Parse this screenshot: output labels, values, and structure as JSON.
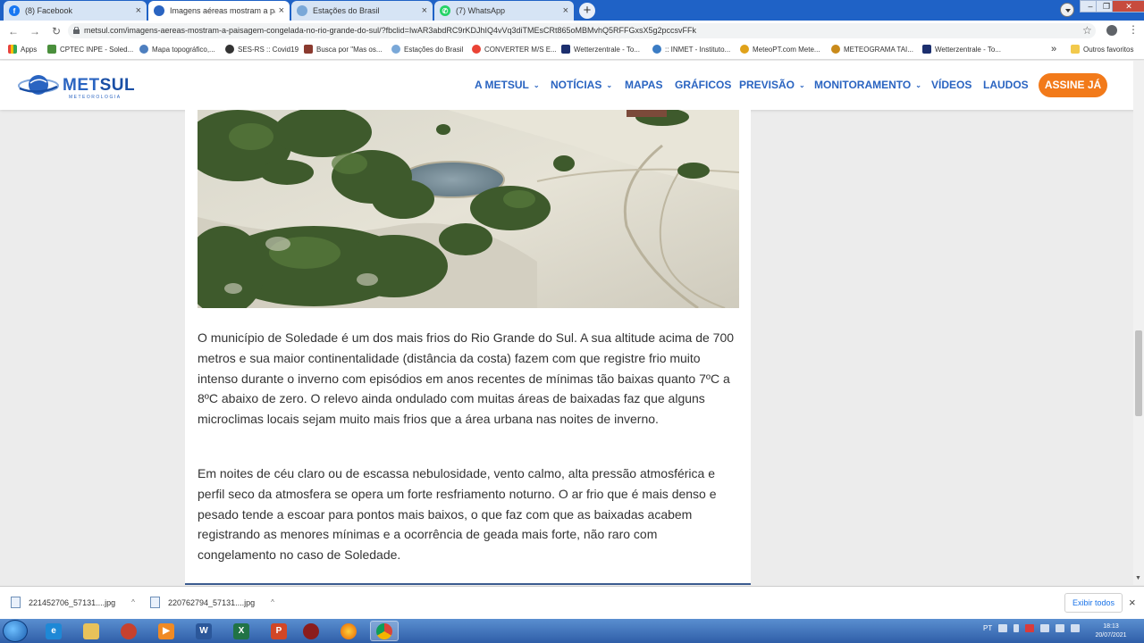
{
  "browser": {
    "tabs": [
      {
        "title": "(8) Facebook",
        "icon": "facebook-icon",
        "color": "#1877f2"
      },
      {
        "title": "Imagens aéreas mostram a paisagem",
        "icon": "metsul-icon",
        "color": "#2a64c1",
        "active": true
      },
      {
        "title": "Estações do Brasil",
        "icon": "stations-icon",
        "color": "#7aa8d8"
      },
      {
        "title": "(7) WhatsApp",
        "icon": "whatsapp-icon",
        "color": "#25d366"
      }
    ],
    "new_tab": "+",
    "url": "metsul.com/imagens-aereas-mostram-a-paisagem-congelada-no-rio-grande-do-sul/?fbclid=IwAR3abdRC9rKDJhIQ4vVq3diTMEsCRt865oMBMvhQ5RFFGxsX5g2pccsvFFk",
    "bookmarks": [
      "Apps",
      "CPTEC INPE - Soled...",
      "Mapa topográfico,...",
      "SES-RS :: Covid19",
      "Busca por \"Mas os...",
      "Estações do Brasil",
      "CONVERTER M/S E...",
      "Wetterzentrale - To...",
      ":: INMET - Instituto...",
      "MeteoPT.com Mete...",
      "METEOGRAMA TAI...",
      "Wetterzentrale - To..."
    ],
    "more_bookmarks": "»",
    "other_bookmarks": "Outros favoritos"
  },
  "site": {
    "logo_main": "MET",
    "logo_bold": "SUL",
    "logo_sub": "METEOROLOGIA",
    "menu": [
      {
        "label": "A METSUL",
        "dropdown": true
      },
      {
        "label": "NOTÍCIAS",
        "dropdown": true
      },
      {
        "label": "MAPAS",
        "dropdown": false
      },
      {
        "label": "GRÁFICOS",
        "dropdown": false
      },
      {
        "label": "PREVISÃO",
        "dropdown": true
      },
      {
        "label": "MONITORAMENTO",
        "dropdown": true
      },
      {
        "label": "VÍDEOS",
        "dropdown": false
      },
      {
        "label": "LAUDOS",
        "dropdown": false
      }
    ],
    "cta": "ASSINE JÁ",
    "accent": "#2a64c1",
    "cta_color": "#f27a1a"
  },
  "article": {
    "paragraphs": [
      "O município de Soledade é um dos mais frios do Rio Grande do Sul. A sua altitude acima de 700 metros e sua maior continentalidade (distância da costa) fazem com que registre frio muito intenso durante o inverno com episódios em anos recentes de mínimas tão baixas quanto 7ºC a 8ºC abaixo de zero. O relevo ainda ondulado com muitas áreas de baixadas faz que alguns microclimas locais sejam muito mais frios que a área urbana nas noites de inverno.",
      "Em noites de céu claro ou de escassa nebulosidade, vento calmo, alta pressão atmosférica e perfil seco da atmosfera se opera um forte resfriamento noturno. O ar frio que é mais denso e pesado tende a escoar para pontos mais baixos, o que faz com que as baixadas acabem registrando as menores mínimas e a ocorrência de geada mais forte, não raro com congelamento no caso de Soledade."
    ]
  },
  "downloads": {
    "items": [
      "221452706_57131....jpg",
      "220762794_57131....jpg"
    ],
    "show_all": "Exibir todos",
    "close": "×"
  },
  "taskbar": {
    "apps": [
      "ie-icon",
      "explorer-icon",
      "app-icon",
      "media-player-icon",
      "word-icon",
      "excel-icon",
      "powerpoint-icon",
      "app-icon",
      "firefox-icon",
      "chrome-icon"
    ],
    "language": "PT",
    "time": "18:13",
    "date": "20/07/2021"
  }
}
